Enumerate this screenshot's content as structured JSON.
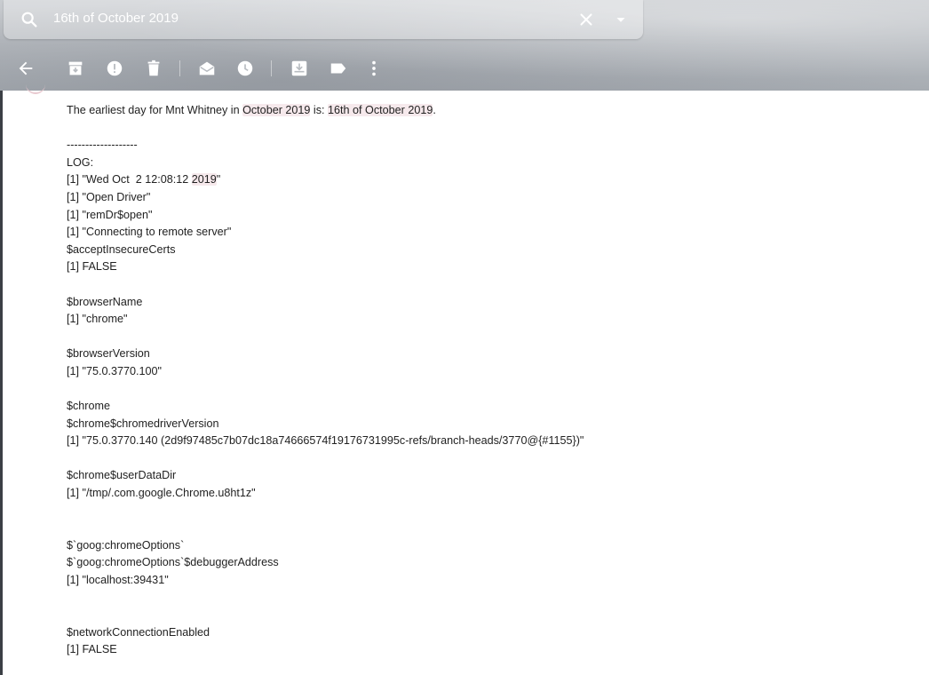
{
  "search": {
    "query": "16th of October 2019"
  },
  "toolbar": {
    "icons": [
      "back-arrow-icon",
      "archive-icon",
      "report-spam-icon",
      "delete-icon",
      "mark-unread-icon",
      "snooze-icon",
      "move-to-icon",
      "label-icon",
      "more-vert-icon"
    ]
  },
  "email": {
    "summary": {
      "prefix": "The earliest day for Mnt Whitney in ",
      "hl1": "October 2019",
      "middle": " is: ",
      "hl2": "16th of October 2019",
      "suffix": "."
    },
    "divider": "-------------------",
    "log_label": "LOG:",
    "date_line": {
      "before": "[1] \"Wed Oct  2 12:08:12 ",
      "hl": "2019",
      "after": "\""
    },
    "lines_a": [
      "[1] \"Open Driver\"",
      "[1] \"remDr$open\"",
      "[1] \"Connecting to remote server\"",
      "$acceptInsecureCerts",
      "[1] FALSE"
    ],
    "lines_b": [
      "$browserName",
      "[1] \"chrome\""
    ],
    "lines_c": [
      "$browserVersion",
      "[1] \"75.0.3770.100\""
    ],
    "lines_d": [
      "$chrome",
      "$chrome$chromedriverVersion",
      "[1] \"75.0.3770.140 (2d9f97485c7b07dc18a74666574f19176731995c-refs/branch-heads/3770@{#1155})\""
    ],
    "lines_e": [
      "$chrome$userDataDir",
      "[1] \"/tmp/.com.google.Chrome.u8ht1z\""
    ],
    "lines_f": [
      "$`goog:chromeOptions`",
      "$`goog:chromeOptions`$debuggerAddress",
      "[1] \"localhost:39431\""
    ],
    "lines_g": [
      "$networkConnectionEnabled",
      "[1] FALSE"
    ]
  }
}
